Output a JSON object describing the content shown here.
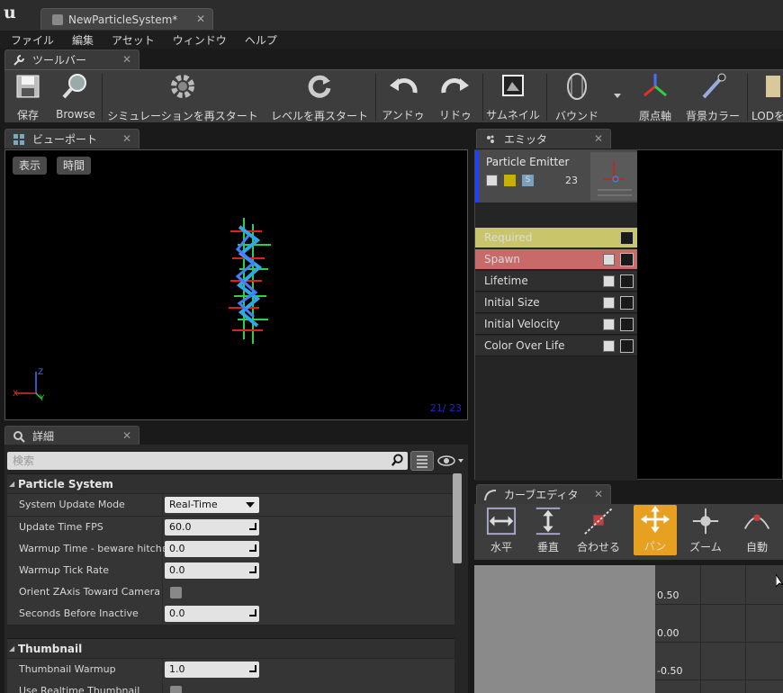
{
  "window": {
    "doc_tab": "NewParticleSystem*"
  },
  "menu": [
    "ファイル",
    "編集",
    "アセット",
    "ウィンドウ",
    "ヘルプ"
  ],
  "toolbar_tab": "ツールバー",
  "toolbar": {
    "buttons": [
      {
        "label": "保存",
        "icon": "save-icon"
      },
      {
        "label": "Browse",
        "icon": "magnifier-icon"
      },
      {
        "label": "シミュレーションを再スタート",
        "icon": "restart-sim-icon"
      },
      {
        "label": "レベルを再スタート",
        "icon": "restart-level-icon"
      },
      {
        "label": "アンドゥ",
        "icon": "undo-icon"
      },
      {
        "label": "リドゥ",
        "icon": "redo-icon"
      },
      {
        "label": "サムネイル",
        "icon": "thumbnail-icon"
      },
      {
        "label": "バウンド",
        "icon": "bounds-icon"
      },
      {
        "label": "原点軸",
        "icon": "origin-axis-icon"
      },
      {
        "label": "背景カラー",
        "icon": "background-color-icon"
      },
      {
        "label": "LODを",
        "icon": "lod-icon"
      }
    ]
  },
  "viewport": {
    "tab": "ビューポート",
    "show_label": "表示",
    "time_label": "時間",
    "counter": "21/  23",
    "axis_z": "Z",
    "axis_x": "X",
    "axis_y": "Y"
  },
  "details": {
    "tab": "詳細",
    "search_placeholder": "検索",
    "categories": [
      {
        "name": "Particle System",
        "props": [
          {
            "label": "System Update Mode",
            "value": "Real-Time",
            "kind": "select"
          },
          {
            "label": "Update Time FPS",
            "value": "60.0",
            "kind": "number"
          },
          {
            "label": "Warmup Time - beware hitches",
            "value": "0.0",
            "kind": "number"
          },
          {
            "label": "Warmup Tick Rate",
            "value": "0.0",
            "kind": "number"
          },
          {
            "label": "Orient ZAxis Toward Camera",
            "value": "",
            "kind": "check"
          },
          {
            "label": "Seconds Before Inactive",
            "value": "0.0",
            "kind": "number"
          }
        ]
      },
      {
        "name": "Thumbnail",
        "props": [
          {
            "label": "Thumbnail Warmup",
            "value": "1.0",
            "kind": "number"
          },
          {
            "label": "Use Realtime Thumbnail",
            "value": "",
            "kind": "check"
          }
        ]
      }
    ]
  },
  "emitter": {
    "tab": "エミッタ",
    "name": "Particle Emitter",
    "count": "23",
    "modules": [
      {
        "name": "Required",
        "color": "#c9c56a",
        "checkbox": false
      },
      {
        "name": "Spawn",
        "color": "#c96a6a",
        "checkbox": true
      },
      {
        "name": "Lifetime",
        "color": "#2f2f2f",
        "checkbox": true
      },
      {
        "name": "Initial Size",
        "color": "#2f2f2f",
        "checkbox": true
      },
      {
        "name": "Initial Velocity",
        "color": "#2f2f2f",
        "checkbox": true
      },
      {
        "name": "Color Over Life",
        "color": "#2f2f2f",
        "checkbox": true
      }
    ]
  },
  "curve_editor": {
    "tab": "カーブエディタ",
    "buttons": [
      {
        "label": "水平",
        "icon": "horizontal-fit-icon"
      },
      {
        "label": "垂直",
        "icon": "vertical-fit-icon"
      },
      {
        "label": "合わせる",
        "icon": "fit-icon"
      },
      {
        "label": "パン",
        "icon": "pan-icon",
        "active": true
      },
      {
        "label": "ズーム",
        "icon": "zoom-icon"
      },
      {
        "label": "自動",
        "icon": "auto-icon"
      }
    ],
    "y_labels": [
      "0.50",
      "0.00",
      "-0.50"
    ]
  },
  "colors": {
    "accent_orange": "#e8a020",
    "emitter_blue": "#1f3fff"
  }
}
